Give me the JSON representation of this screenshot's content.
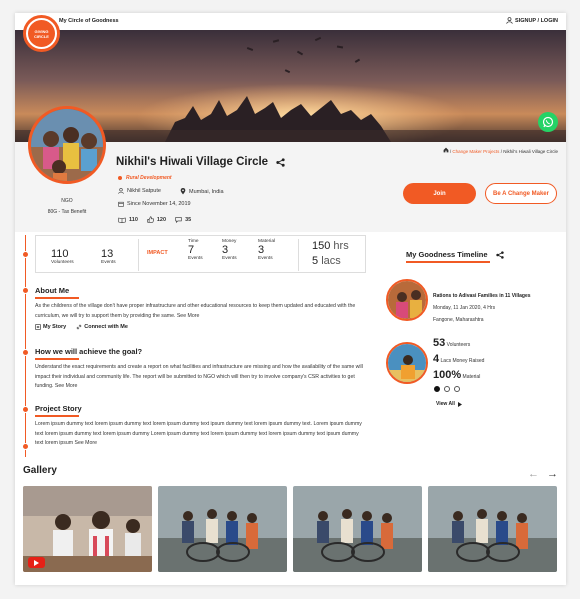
{
  "topbar": {
    "brand": "My Circle of Goodness",
    "signup": "SIGNUP / LOGIN"
  },
  "logo": {
    "text_line1": "GIVING",
    "text_line2": "CIRCLE"
  },
  "breadcrumb": {
    "link": "Change Maker Projects",
    "current": "Nikhil's Hiwali Village Circle"
  },
  "circle": {
    "title": "Nikhil's Hiwali Village Circle",
    "category": "Rural Development",
    "owner": "Nikhil Satpute",
    "location": "Mumbai, India",
    "since": "Since November 14, 2019",
    "org_type": "NGO",
    "tax": "80G - Tax Benefit",
    "followers": "110",
    "likes": "120",
    "comments": "35"
  },
  "buttons": {
    "join": "Join",
    "change_maker": "Be A Change Maker"
  },
  "stats": {
    "volunteers_num": "110",
    "volunteers_label": "Volunteers",
    "events_num": "13",
    "events_label": "Events",
    "impact_label": "IMPACT",
    "time_label": "Time",
    "time_num": "7",
    "time_events": "Events",
    "money_label": "Money",
    "money_num": "3",
    "money_events": "Events",
    "material_label": "Material",
    "material_num": "3",
    "material_events": "Events",
    "hrs_num": "150",
    "hrs_unit": "hrs",
    "lacs_num": "5",
    "lacs_unit": "lacs"
  },
  "about": {
    "title": "About Me",
    "text": "As the childrens of the village don't have proper infrastructure and other educational resources to keep them updated and educated with the curriculum, we will try to support them by providing the same. See More",
    "story_link": "My Story",
    "connect_link": "Connect with Me"
  },
  "goal": {
    "title": "How we will achieve the goal?",
    "text": "Understand the exact requirements and create a report on what facilities and infrastructure are missing and how the availability of the same will impact their individual and community life. The report will be submitted to NGO which will then try to involve company's CSR activities to get funding. See More"
  },
  "story": {
    "title": "Project Story",
    "text": "Lorem ipsum dummy text lorem ipsum dummy text lorem ipsum dummy text ipsum dummy text lorem ipsum dummy text. Lorem ipsum dummy text lorem ipsum dummy text lorem ipsum dummy Lorem ipsum dummy text lorem ipsum dummy text lorem ipsum dummy text ipsum dummy text lorem ipsum See More"
  },
  "timeline": {
    "title": "My Goodness Timeline",
    "event_title": "Rations to Adivasi Families in 11 Villages",
    "event_date": "Monday, 11 Jan 2020, 4 Hrs",
    "event_place": "Fangone, Maharashtra",
    "volunteers_num": "53",
    "volunteers_label": "Volunteers",
    "money_num": "4",
    "money_label": "Lacs Money Raised",
    "material_num": "100%",
    "material_label": "Material",
    "view_all": "View All"
  },
  "gallery": {
    "title": "Gallery"
  },
  "colors": {
    "accent": "#f15a24",
    "whatsapp": "#25d366"
  }
}
